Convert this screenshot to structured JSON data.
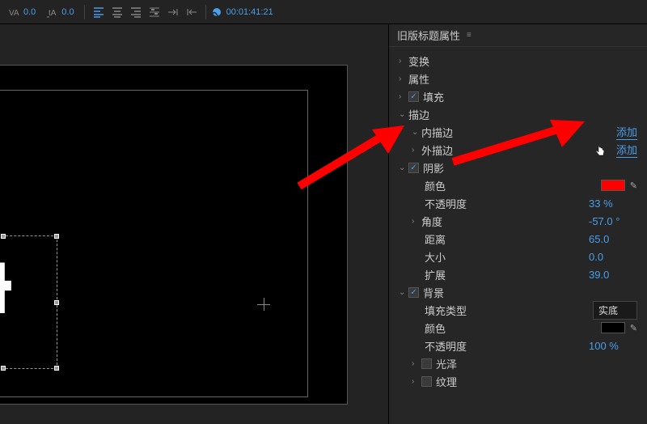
{
  "toolbar": {
    "kern_value": "0.0",
    "baseline_value": "0.0",
    "timecode": "00:01:41:21"
  },
  "panel": {
    "title": "旧版标题属性",
    "sections": {
      "transform": "变换",
      "properties": "属性",
      "fill": "填充",
      "stroke": "描边",
      "inner_stroke": "内描边",
      "outer_stroke": "外描边",
      "add_link": "添加",
      "shadow": "阴影",
      "color_label": "颜色",
      "opacity_label": "不透明度",
      "opacity_value": "33 %",
      "angle_label": "角度",
      "angle_value": "-57.0 °",
      "distance_label": "距离",
      "distance_value": "65.0",
      "size_label": "大小",
      "size_value": "0.0",
      "spread_label": "扩展",
      "spread_value": "39.0",
      "background": "背景",
      "fill_type_label": "填充类型",
      "fill_type_value": "实底",
      "bg_opacity_value": "100 %",
      "sheen": "光泽",
      "texture": "纹理"
    }
  },
  "canvas": {
    "sample_text": "静",
    "shadow_color": "#ff0000",
    "bg_color": "#000000"
  }
}
